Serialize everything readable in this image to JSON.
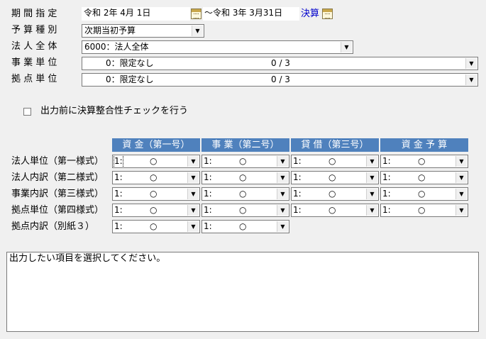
{
  "labels": {
    "period": "期 間 指 定",
    "budget_type": "予 算 種 別",
    "corporation": "法 人 全 体",
    "business_unit": "事 業 単 位",
    "base_unit": "拠 点 単 位"
  },
  "period": {
    "from": "令和 2年 4月 1日",
    "to": "～令和 3年 3月31日",
    "kessan": "決算"
  },
  "budget_type": {
    "value": "次期当初予算"
  },
  "corporation": {
    "value": "6000：法人全体"
  },
  "business_unit": {
    "value": "0：限定なし",
    "count": "0 / 3"
  },
  "base_unit": {
    "value": "0：限定なし",
    "count": "0 / 3"
  },
  "checkbox": {
    "label": "出力前に決算整合性チェックを行う"
  },
  "columns": [
    "資 金（第一号）",
    "事 業（第二号）",
    "貸 借（第三号）",
    "資 金 予 算"
  ],
  "rows": [
    {
      "label": "法人単位（第一様式）",
      "cells": [
        {
          "code": "1:",
          "mark": "○"
        },
        {
          "code": "1:",
          "mark": "○"
        },
        {
          "code": "1:",
          "mark": "○"
        },
        {
          "code": "1:",
          "mark": "○"
        }
      ]
    },
    {
      "label": "法人内訳（第二様式）",
      "cells": [
        {
          "code": "1:",
          "mark": "○"
        },
        {
          "code": "1:",
          "mark": "○"
        },
        {
          "code": "1:",
          "mark": "○"
        },
        {
          "code": "1:",
          "mark": "○"
        }
      ]
    },
    {
      "label": "事業内訳（第三様式）",
      "cells": [
        {
          "code": "1:",
          "mark": "○"
        },
        {
          "code": "1:",
          "mark": "○"
        },
        {
          "code": "1:",
          "mark": "○"
        },
        {
          "code": "1:",
          "mark": "○"
        }
      ]
    },
    {
      "label": "拠点単位（第四様式）",
      "cells": [
        {
          "code": "1:",
          "mark": "○"
        },
        {
          "code": "1:",
          "mark": "○"
        },
        {
          "code": "1:",
          "mark": "○"
        },
        {
          "code": "1:",
          "mark": "○"
        }
      ]
    },
    {
      "label": "拠点内訳（別紙３）",
      "cells": [
        {
          "code": "1:",
          "mark": "○"
        },
        {
          "code": "1:",
          "mark": "○"
        }
      ]
    }
  ],
  "message": "出力したい項目を選択してください。",
  "colors": {
    "header_bg": "#4f81bd",
    "window_bg": "#f0f0f0",
    "link_blue": "#0000cc"
  }
}
